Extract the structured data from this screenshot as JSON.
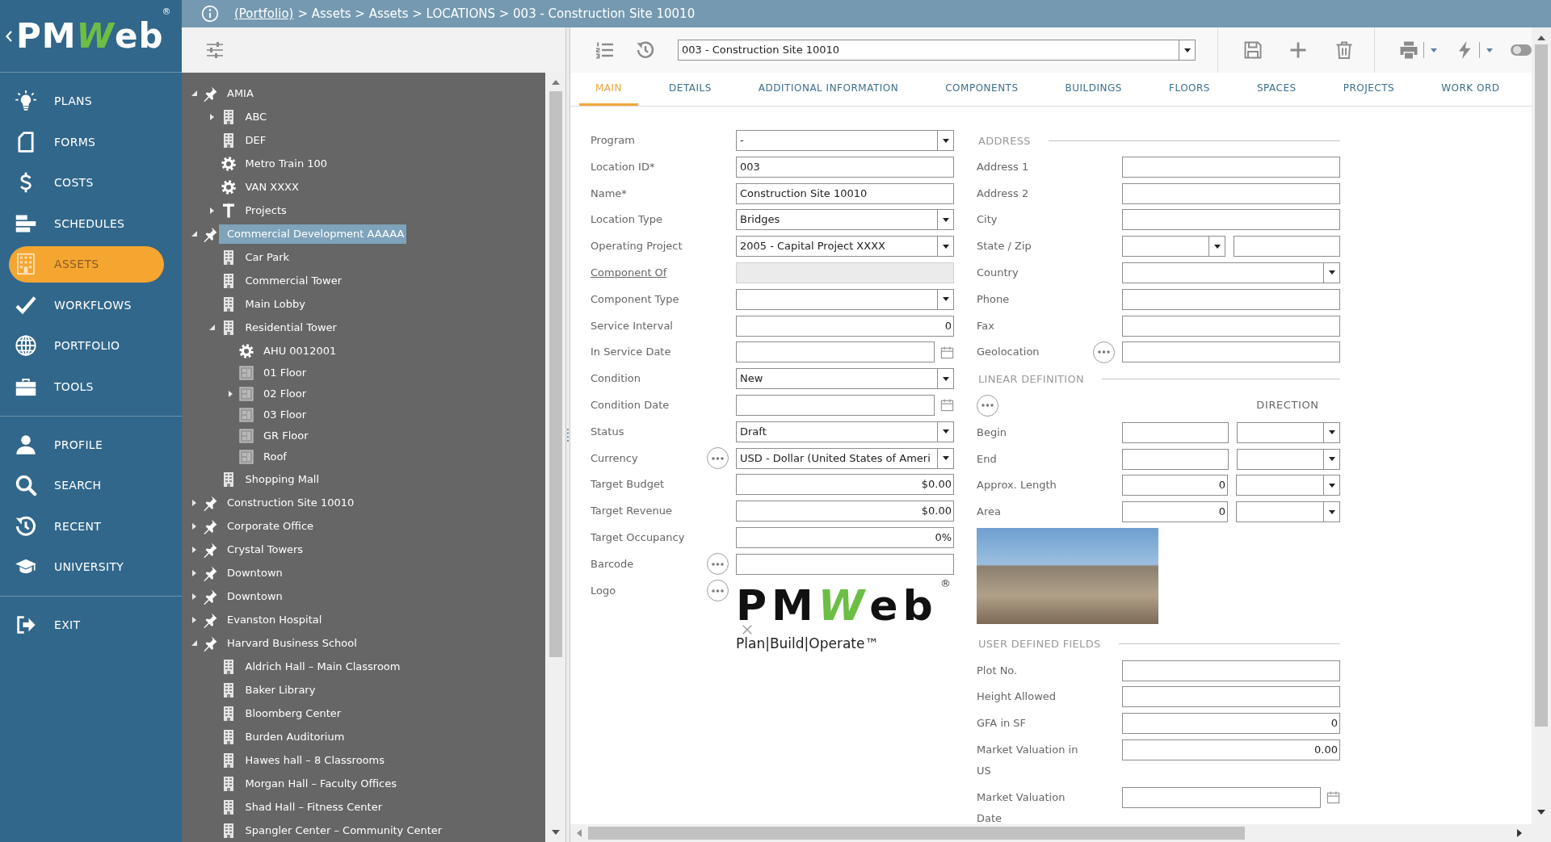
{
  "sidebar": {
    "logo": {
      "wordmark": [
        "PM",
        "W",
        "eb"
      ],
      "mark": "®"
    },
    "nav_groups": [
      [
        {
          "label": "PLANS",
          "kind": "plans",
          "selected": false
        },
        {
          "label": "FORMS",
          "kind": "forms",
          "selected": false
        },
        {
          "label": "COSTS",
          "kind": "costs",
          "selected": false
        },
        {
          "label": "SCHEDULES",
          "kind": "schedules",
          "selected": false
        },
        {
          "label": "ASSETS",
          "kind": "assets",
          "selected": true
        },
        {
          "label": "WORKFLOWS",
          "kind": "workflows",
          "selected": false
        },
        {
          "label": "PORTFOLIO",
          "kind": "portfolio",
          "selected": false
        },
        {
          "label": "TOOLS",
          "kind": "tools",
          "selected": false
        }
      ],
      [
        {
          "label": "PROFILE",
          "kind": "profile",
          "selected": false
        },
        {
          "label": "SEARCH",
          "kind": "search",
          "selected": false
        },
        {
          "label": "RECENT",
          "kind": "recent",
          "selected": false
        },
        {
          "label": "UNIVERSITY",
          "kind": "university",
          "selected": false
        }
      ],
      [
        {
          "label": "EXIT",
          "kind": "exit",
          "selected": false
        }
      ]
    ]
  },
  "breadcrumb": {
    "link": "(Portfolio)",
    "trail": "> Assets > Assets > LOCATIONS > 003 - Construction Site 10010"
  },
  "tree": {
    "items": [
      {
        "label": "AMIA",
        "kind": "site",
        "expanded": true,
        "selected": false,
        "children": [
          {
            "label": "ABC",
            "kind": "building",
            "expanded": false,
            "selected": false
          },
          {
            "label": "DEF",
            "kind": "building",
            "selected": false
          },
          {
            "label": "Metro Train 100",
            "kind": "equipment",
            "selected": false
          },
          {
            "label": "VAN XXXX",
            "kind": "equipment",
            "selected": false
          },
          {
            "label": "Projects",
            "kind": "project",
            "expanded": false,
            "selected": false
          }
        ]
      },
      {
        "label": "Commercial Development AAAAA",
        "kind": "site",
        "expanded": true,
        "selected": true,
        "children": [
          {
            "label": "Car Park",
            "kind": "building",
            "selected": false
          },
          {
            "label": "Commercial Tower",
            "kind": "building",
            "selected": false
          },
          {
            "label": "Main Lobby",
            "kind": "building",
            "selected": false
          },
          {
            "label": "Residential Tower",
            "kind": "building",
            "expanded": true,
            "selected": false,
            "children": [
              {
                "label": "AHU 0012001",
                "kind": "equipment",
                "selected": false
              },
              {
                "label": "01 Floor",
                "kind": "floor",
                "selected": false
              },
              {
                "label": "02 Floor",
                "kind": "floor",
                "expanded": false,
                "selected": false
              },
              {
                "label": "03 Floor",
                "kind": "floor",
                "selected": false
              },
              {
                "label": "GR Floor",
                "kind": "floor",
                "selected": false
              },
              {
                "label": "Roof",
                "kind": "floor",
                "selected": false
              }
            ]
          },
          {
            "label": "Shopping Mall",
            "kind": "building",
            "selected": false
          }
        ]
      },
      {
        "label": "Construction Site 10010",
        "kind": "site",
        "expanded": false,
        "selected": false
      },
      {
        "label": "Corporate Office",
        "kind": "site",
        "expanded": false,
        "selected": false
      },
      {
        "label": "Crystal Towers",
        "kind": "site",
        "expanded": false,
        "selected": false
      },
      {
        "label": "Downtown",
        "kind": "site",
        "expanded": false,
        "selected": false
      },
      {
        "label": "Downtown",
        "kind": "site",
        "expanded": false,
        "selected": false
      },
      {
        "label": "Evanston Hospital",
        "kind": "site",
        "expanded": false,
        "selected": false
      },
      {
        "label": "Harvard Business School",
        "kind": "site",
        "expanded": true,
        "selected": false,
        "children": [
          {
            "label": "Aldrich Hall – Main Classroom",
            "kind": "building",
            "selected": false
          },
          {
            "label": "Baker Library",
            "kind": "building",
            "selected": false
          },
          {
            "label": "Bloomberg Center",
            "kind": "building",
            "selected": false
          },
          {
            "label": "Burden Auditorium",
            "kind": "building",
            "selected": false
          },
          {
            "label": "Hawes hall – 8 Classrooms",
            "kind": "building",
            "selected": false
          },
          {
            "label": "Morgan Hall – Faculty Offices",
            "kind": "building",
            "selected": false
          },
          {
            "label": "Shad Hall – Fitness Center",
            "kind": "building",
            "selected": false
          },
          {
            "label": "Spangler Center – Community Center",
            "kind": "building",
            "selected": false
          }
        ]
      }
    ]
  },
  "toolbar": {
    "record": "003 - Construction Site 10010"
  },
  "tabs": [
    {
      "label": "MAIN",
      "selected": true
    },
    {
      "label": "DETAILS",
      "selected": false
    },
    {
      "label": "ADDITIONAL INFORMATION",
      "selected": false
    },
    {
      "label": "COMPONENTS",
      "selected": false
    },
    {
      "label": "BUILDINGS",
      "selected": false
    },
    {
      "label": "FLOORS",
      "selected": false
    },
    {
      "label": "SPACES",
      "selected": false
    },
    {
      "label": "PROJECTS",
      "selected": false
    },
    {
      "label": "WORK ORD",
      "selected": false
    }
  ],
  "form": {
    "columns": [
      {
        "blocks": [
          {
            "kind": "section",
            "rows": [
              {
                "label": "Program",
                "link": false,
                "picker": false,
                "fields": [
                  {
                    "kind": "select",
                    "value": "-"
                  }
                ]
              },
              {
                "label": "Location ID*",
                "link": false,
                "picker": false,
                "fields": [
                  {
                    "kind": "text",
                    "value": "003"
                  }
                ]
              },
              {
                "label": "Name*",
                "link": false,
                "picker": false,
                "fields": [
                  {
                    "kind": "text",
                    "value": "Construction Site 10010"
                  }
                ]
              },
              {
                "label": "Location Type",
                "link": false,
                "picker": false,
                "fields": [
                  {
                    "kind": "select",
                    "value": "Bridges"
                  }
                ]
              },
              {
                "label": "Operating Project",
                "link": false,
                "picker": false,
                "fields": [
                  {
                    "kind": "select",
                    "value": "2005 - Capital Project XXXX"
                  }
                ]
              },
              {
                "label": "Component Of",
                "link": true,
                "picker": false,
                "fields": [
                  {
                    "kind": "readonly"
                  }
                ]
              },
              {
                "label": "Component Type",
                "link": false,
                "picker": false,
                "fields": [
                  {
                    "kind": "select"
                  }
                ]
              },
              {
                "label": "Service Interval",
                "link": false,
                "picker": false,
                "fields": [
                  {
                    "kind": "number",
                    "value": "0"
                  }
                ]
              },
              {
                "label": "In Service Date",
                "link": false,
                "picker": false,
                "fields": [
                  {
                    "kind": "date"
                  }
                ]
              },
              {
                "label": "Condition",
                "link": false,
                "picker": false,
                "fields": [
                  {
                    "kind": "select",
                    "value": "New"
                  }
                ]
              },
              {
                "label": "Condition Date",
                "link": false,
                "picker": false,
                "fields": [
                  {
                    "kind": "date"
                  }
                ]
              },
              {
                "label": "Status",
                "link": false,
                "picker": false,
                "fields": [
                  {
                    "kind": "select",
                    "value": "Draft"
                  }
                ]
              },
              {
                "label": "Currency",
                "link": false,
                "picker": true,
                "fields": [
                  {
                    "kind": "select",
                    "value": "USD - Dollar (United States of Ameri"
                  }
                ]
              },
              {
                "label": "Target Budget",
                "link": false,
                "picker": false,
                "fields": [
                  {
                    "kind": "number",
                    "value": "$0.00"
                  }
                ]
              },
              {
                "label": "Target Revenue",
                "link": false,
                "picker": false,
                "fields": [
                  {
                    "kind": "number",
                    "value": "$0.00"
                  }
                ]
              },
              {
                "label": "Target Occupancy",
                "link": false,
                "picker": false,
                "fields": [
                  {
                    "kind": "number",
                    "value": "0%"
                  }
                ]
              },
              {
                "label": "Barcode",
                "link": false,
                "picker": true,
                "fields": [
                  {
                    "kind": "text"
                  }
                ]
              },
              {
                "label": "Logo",
                "link": false,
                "picker": true,
                "fields": [
                  {
                    "kind": "logo",
                    "wordmark": [
                      "PM",
                      "W",
                      "eb"
                    ],
                    "mark": "®",
                    "tagline": "Plan|Build|Operate™"
                  }
                ]
              }
            ]
          }
        ]
      },
      {
        "blocks": [
          {
            "kind": "section",
            "title": "ADDRESS",
            "rows": [
              {
                "label": "Address 1",
                "picker": false,
                "fields": [
                  {
                    "kind": "text"
                  }
                ]
              },
              {
                "label": "Address 2",
                "picker": false,
                "fields": [
                  {
                    "kind": "text"
                  }
                ]
              },
              {
                "label": "City",
                "picker": false,
                "fields": [
                  {
                    "kind": "text"
                  }
                ]
              },
              {
                "label": "State / Zip",
                "picker": false,
                "fields": [
                  {
                    "kind": "select"
                  },
                  {
                    "kind": "text"
                  }
                ]
              },
              {
                "label": "Country",
                "picker": false,
                "fields": [
                  {
                    "kind": "select"
                  }
                ]
              },
              {
                "label": "Phone",
                "picker": false,
                "fields": [
                  {
                    "kind": "text"
                  }
                ]
              },
              {
                "label": "Fax",
                "picker": false,
                "fields": [
                  {
                    "kind": "text"
                  }
                ]
              },
              {
                "label": "Geolocation",
                "picker": true,
                "fields": [
                  {
                    "kind": "text"
                  }
                ]
              }
            ]
          },
          {
            "kind": "section",
            "title": "LINEAR DEFINITION",
            "picker": true,
            "column_heading": "DIRECTION",
            "rows": [
              {
                "label": "Begin",
                "picker": false,
                "fields": [
                  {
                    "kind": "text"
                  },
                  {
                    "kind": "select"
                  }
                ]
              },
              {
                "label": "End",
                "picker": false,
                "fields": [
                  {
                    "kind": "text"
                  },
                  {
                    "kind": "select"
                  }
                ]
              },
              {
                "label": "Approx. Length",
                "picker": false,
                "fields": [
                  {
                    "kind": "number",
                    "value": "0"
                  },
                  {
                    "kind": "select"
                  }
                ]
              },
              {
                "label": "Area",
                "picker": false,
                "fields": [
                  {
                    "kind": "number",
                    "value": "0"
                  },
                  {
                    "kind": "select"
                  }
                ]
              }
            ]
          },
          {
            "kind": "photo"
          },
          {
            "kind": "section",
            "title": "USER DEFINED FIELDS",
            "rows": [
              {
                "label": "Plot No.",
                "picker": false,
                "fields": [
                  {
                    "kind": "text"
                  }
                ]
              },
              {
                "label": "Height Allowed",
                "picker": false,
                "fields": [
                  {
                    "kind": "text"
                  }
                ]
              },
              {
                "label": "GFA in SF",
                "picker": false,
                "fields": [
                  {
                    "kind": "number",
                    "value": "0"
                  }
                ]
              },
              {
                "label": "Market Valuation in US",
                "picker": false,
                "fields": [
                  {
                    "kind": "number",
                    "value": "0.00"
                  }
                ]
              },
              {
                "label": "Market Valuation Date",
                "picker": false,
                "fields": [
                  {
                    "kind": "date"
                  }
                ]
              }
            ]
          }
        ]
      }
    ]
  }
}
